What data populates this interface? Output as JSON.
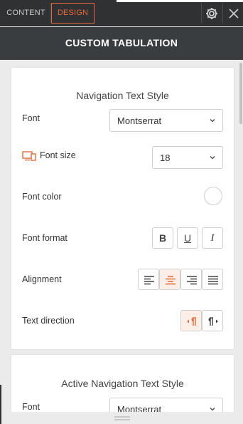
{
  "tabs": {
    "content_label": "CONTENT",
    "design_label": "DESIGN",
    "active": "DESIGN"
  },
  "icons": {
    "settings": "gear-icon",
    "close": "close-icon"
  },
  "panel": {
    "title": "CUSTOM TABULATION"
  },
  "nav_text_style": {
    "section_title": "Navigation Text Style",
    "font": {
      "label": "Font",
      "value": "Montserrat"
    },
    "font_size": {
      "label": "Font size",
      "value": "18",
      "device_icon": "desktop-tablet-icon"
    },
    "font_color": {
      "label": "Font color",
      "value": "#ffffff"
    },
    "font_format": {
      "label": "Font format",
      "bold": "B",
      "underline": "U",
      "italic": "I"
    },
    "alignment": {
      "label": "Alignment",
      "options": [
        "left",
        "center",
        "right",
        "justify"
      ],
      "selected": "center"
    },
    "text_direction": {
      "label": "Text direction",
      "options": [
        "rtl",
        "ltr"
      ],
      "selected": "rtl"
    }
  },
  "active_nav_text_style": {
    "section_title": "Active Navigation Text Style",
    "font": {
      "label": "Font",
      "value": "Montserrat"
    }
  },
  "colors": {
    "accent": "#e86a3a",
    "topbar_bg": "#2f3133",
    "titlebar_bg": "#3a3d40",
    "panel_bg": "#ebebeb"
  }
}
